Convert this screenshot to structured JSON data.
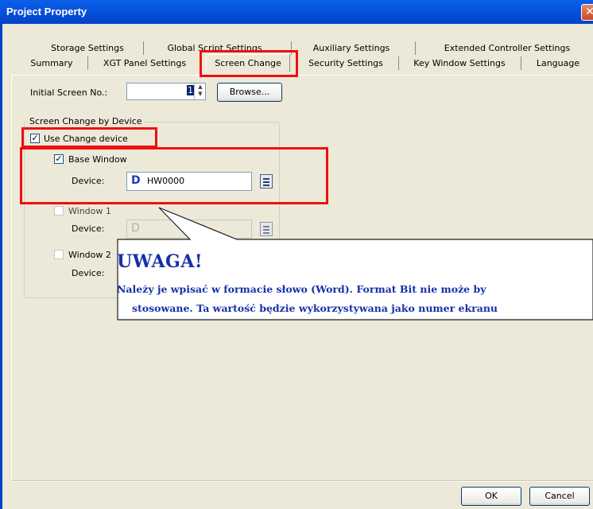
{
  "window": {
    "title": "Project Property",
    "close_glyph": "✕"
  },
  "tabs_back": [
    "Storage Settings",
    "Global Script Settings",
    "Auxiliary Settings",
    "Extended Controller Settings"
  ],
  "tabs_front": [
    "Summary",
    "XGT Panel Settings",
    "Screen Change",
    "Security Settings",
    "Key Window Settings",
    "Language"
  ],
  "active_tab": "Screen Change",
  "initial_screen": {
    "label": "Initial Screen No.:",
    "value": "1",
    "browse_label": "Browse..."
  },
  "group": {
    "title": "Screen Change by Device",
    "use_change_device": {
      "label": "Use Change device",
      "checked": true
    },
    "base_window": {
      "label": "Base Window",
      "checked": true,
      "device_label": "Device:",
      "device_type": "D",
      "device_value": "HW0000"
    },
    "window1": {
      "label": "Window 1",
      "checked": false,
      "device_label": "Device:",
      "device_type": "D",
      "device_value": ""
    },
    "window2": {
      "label": "Window 2",
      "checked": false,
      "device_label": "Device:"
    }
  },
  "callout": {
    "title": "UWAGA!",
    "line1": "Należy je wpisać w formacie słowo (Word). Format Bit nie może by",
    "line2": "stosowane. Ta wartość będzie wykorzystywana jako numer ekranu"
  },
  "footer": {
    "ok_label": "OK",
    "cancel_label": "Cancel"
  },
  "icons": {
    "close": "close-icon",
    "checkmark": "checkmark-icon",
    "spinner": "spinner-arrows-icon",
    "device_picker": "device-picker-icon"
  },
  "colors": {
    "titlebar": "#0753DC",
    "dialog_bg": "#ECE9D8",
    "highlight_red": "#F00F0F",
    "callout_text": "#1530A8"
  }
}
